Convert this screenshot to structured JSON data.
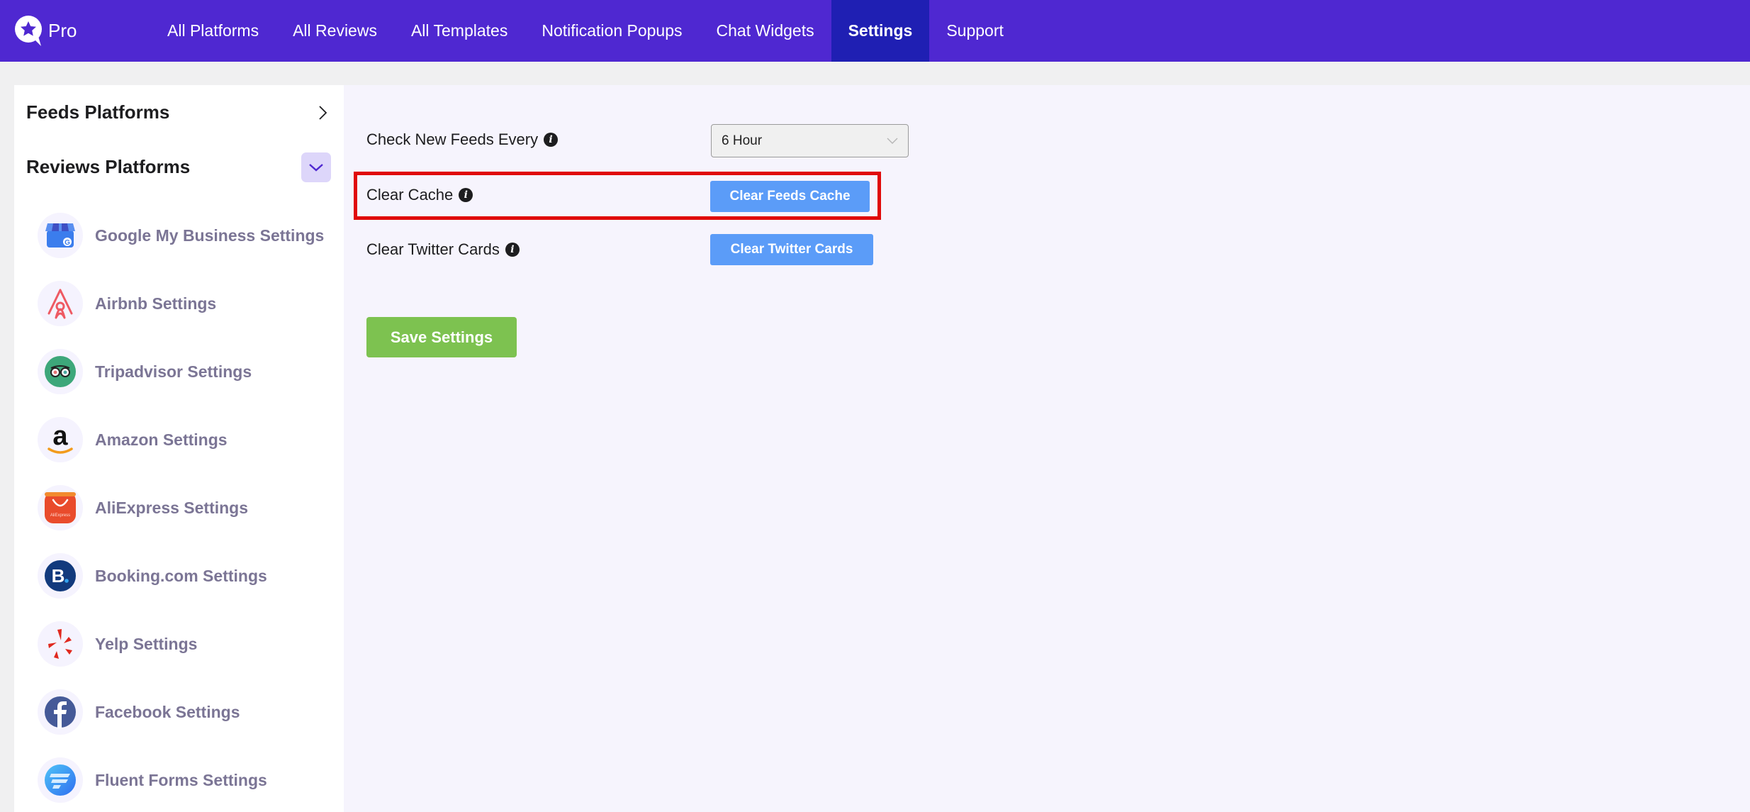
{
  "header": {
    "logo_text": "Pro",
    "nav": [
      {
        "label": "All Platforms",
        "active": false
      },
      {
        "label": "All Reviews",
        "active": false
      },
      {
        "label": "All Templates",
        "active": false
      },
      {
        "label": "Notification Popups",
        "active": false
      },
      {
        "label": "Chat Widgets",
        "active": false
      },
      {
        "label": "Settings",
        "active": true
      },
      {
        "label": "Support",
        "active": false
      }
    ]
  },
  "sidebar": {
    "feeds_title": "Feeds Platforms",
    "reviews_title": "Reviews Platforms",
    "platforms": [
      {
        "label": "Google My Business Settings",
        "icon": "google-my-business-icon"
      },
      {
        "label": "Airbnb Settings",
        "icon": "airbnb-icon"
      },
      {
        "label": "Tripadvisor Settings",
        "icon": "tripadvisor-icon"
      },
      {
        "label": "Amazon Settings",
        "icon": "amazon-icon"
      },
      {
        "label": "AliExpress Settings",
        "icon": "aliexpress-icon"
      },
      {
        "label": "Booking.com Settings",
        "icon": "booking-icon"
      },
      {
        "label": "Yelp Settings",
        "icon": "yelp-icon"
      },
      {
        "label": "Facebook Settings",
        "icon": "facebook-icon"
      },
      {
        "label": "Fluent Forms Settings",
        "icon": "fluent-forms-icon"
      }
    ]
  },
  "settings": {
    "check_feeds_label": "Check New Feeds Every",
    "check_feeds_value": "6 Hour",
    "clear_cache_label": "Clear Cache",
    "clear_cache_button": "Clear Feeds Cache",
    "clear_twitter_label": "Clear Twitter Cards",
    "clear_twitter_button": "Clear Twitter Cards",
    "save_button": "Save Settings",
    "info_glyph": "i"
  },
  "colors": {
    "header": "#4f28d1",
    "active_nav": "#1f1fb3",
    "primary_button": "#5b9cf8",
    "save_button": "#7dc250",
    "highlight": "#e00a0a"
  }
}
